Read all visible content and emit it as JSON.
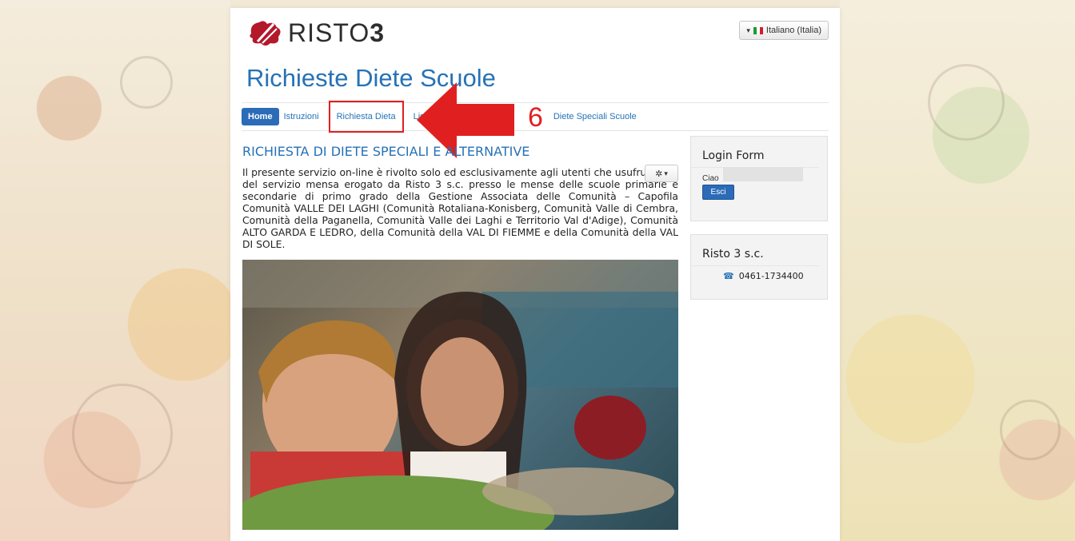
{
  "header": {
    "logo_text": "RISTO",
    "logo_number": "3",
    "site_title": "Richieste Diete Scuole",
    "language_label": "Italiano (Italia)",
    "language_caret": "▾"
  },
  "nav": {
    "items": [
      {
        "label": "Home"
      },
      {
        "label": "Istruzioni"
      },
      {
        "label": "Richiesta Dieta"
      },
      {
        "label": "Lista"
      },
      {
        "label": "Diete Speciali Scuole"
      }
    ]
  },
  "annotation": {
    "step": "6"
  },
  "article": {
    "title": "RICHIESTA DI DIETE SPECIALI E ALTERNATIVE",
    "text": "Il presente servizio on-line è rivolto solo ed esclusivamente agli utenti che usufruiscono del servizio mensa erogato da Risto 3 s.c. presso le mense delle scuole primarie e secondarie di primo grado della Gestione Associata delle Comunità – Capofila Comunità VALLE DEI LAGHI (Comunità Rotaliana-Konisberg, Comunità Valle di Cembra, Comunità della Paganella, Comunità Valle dei Laghi e Territorio Val d'Adige), Comunità ALTO GARDA E LEDRO, della Comunità della VAL DI FIEMME e della Comunità della VAL DI SOLE.",
    "gear_caret": "▾"
  },
  "login": {
    "title": "Login Form",
    "greeting": "Ciao",
    "logout_label": "Esci"
  },
  "company": {
    "title": "Risto 3 s.c.",
    "phone": "0461-1734400"
  },
  "colors": {
    "brand_blue": "#2672b6",
    "annotation_red": "#e02020"
  }
}
